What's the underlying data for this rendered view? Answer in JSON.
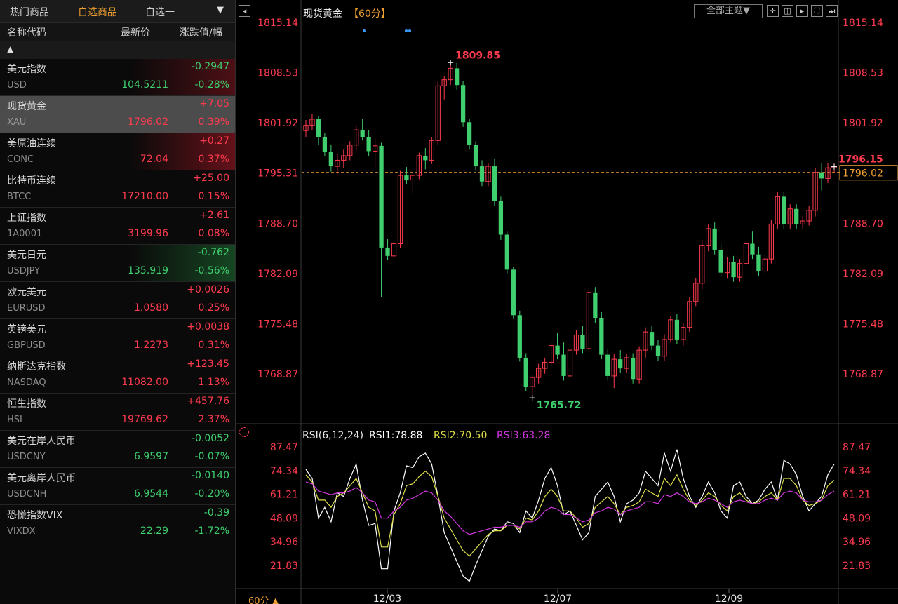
{
  "tabs": [
    "热门商品",
    "自选商品",
    "自选一"
  ],
  "tab_dropdown": "▼",
  "columns": {
    "name": "名称代码",
    "price": "最新价",
    "change": "涨跌值/幅"
  },
  "sort_indicator": "▲",
  "watchlist": [
    {
      "name": "美元指数",
      "code": "USD",
      "price": "104.5211",
      "change": "-0.2947",
      "pct": "-0.28%",
      "dir": "down"
    },
    {
      "name": "现货黄金",
      "code": "XAU",
      "price": "1796.02",
      "change": "+7.05",
      "pct": "0.39%",
      "dir": "up"
    },
    {
      "name": "美原油连续",
      "code": "CONC",
      "price": "72.04",
      "change": "+0.27",
      "pct": "0.37%",
      "dir": "up"
    },
    {
      "name": "比特币连续",
      "code": "BTCC",
      "price": "17210.00",
      "change": "+25.00",
      "pct": "0.15%",
      "dir": "up"
    },
    {
      "name": "上证指数",
      "code": "1A0001",
      "price": "3199.96",
      "change": "+2.61",
      "pct": "0.08%",
      "dir": "up"
    },
    {
      "name": "美元日元",
      "code": "USDJPY",
      "price": "135.919",
      "change": "-0.762",
      "pct": "-0.56%",
      "dir": "down"
    },
    {
      "name": "欧元美元",
      "code": "EURUSD",
      "price": "1.0580",
      "change": "+0.0026",
      "pct": "0.25%",
      "dir": "up"
    },
    {
      "name": "英镑美元",
      "code": "GBPUSD",
      "price": "1.2273",
      "change": "+0.0038",
      "pct": "0.31%",
      "dir": "up"
    },
    {
      "name": "纳斯达克指数",
      "code": "NASDAQ",
      "price": "11082.00",
      "change": "+123.45",
      "pct": "1.13%",
      "dir": "up"
    },
    {
      "name": "恒生指数",
      "code": "HSI",
      "price": "19769.62",
      "change": "+457.76",
      "pct": "2.37%",
      "dir": "up"
    },
    {
      "name": "美元在岸人民币",
      "code": "USDCNY",
      "price": "6.9597",
      "change": "-0.0052",
      "pct": "-0.07%",
      "dir": "down"
    },
    {
      "name": "美元离岸人民币",
      "code": "USDCNH",
      "price": "6.9544",
      "change": "-0.0140",
      "pct": "-0.20%",
      "dir": "down"
    },
    {
      "name": "恐慌指数VIX",
      "code": "VIXDX",
      "price": "22.29",
      "change": "-0.39",
      "pct": "-1.72%",
      "dir": "down"
    }
  ],
  "chart_header": {
    "title": "现货黄金",
    "period": "【60分】",
    "theme_button": "全部主题▼"
  },
  "toolbar_icons": [
    "crosshair-icon",
    "split-layout-icon",
    "next-frame-icon",
    "fullscreen-icon",
    "end-bar-icon"
  ],
  "rsi_header": {
    "label": "RSI(6,12,24)",
    "rsi1": "RSI1:78.88",
    "rsi2": "RSI2:70.50",
    "rsi3": "RSI3:63.28"
  },
  "bottom_period": "60分 ▲",
  "colors": {
    "up": "#ff3b4e",
    "down": "#3fcf6e",
    "rsi1": "#ffffff",
    "rsi2": "#e0e04a",
    "rsi3": "#d238e0",
    "last_price": "#f0a030"
  },
  "chart_data": [
    {
      "type": "candlestick",
      "title": "现货黄金",
      "yticks": [
        "1815.14",
        "1808.53",
        "1801.92",
        "1795.31",
        "1788.70",
        "1782.09",
        "1775.48",
        "1768.87"
      ],
      "ylim": [
        1761.0,
        1816.0
      ],
      "xticks": [
        "12/03",
        "12/07",
        "12/09"
      ],
      "high_label": "1809.85",
      "low_label": "1765.72",
      "last_label": "1796.15",
      "current_price": "1796.02",
      "reference_price": 1795.4,
      "ohlc": [
        [
          1800.9,
          1802.3,
          1800.0,
          1801.6
        ],
        [
          1801.6,
          1803.1,
          1801.0,
          1802.4
        ],
        [
          1802.4,
          1802.8,
          1799.0,
          1800.0
        ],
        [
          1800.0,
          1800.6,
          1797.5,
          1798.1
        ],
        [
          1798.1,
          1799.0,
          1795.5,
          1796.2
        ],
        [
          1796.2,
          1797.8,
          1795.2,
          1797.0
        ],
        [
          1797.0,
          1798.4,
          1796.0,
          1797.6
        ],
        [
          1797.6,
          1799.5,
          1797.0,
          1799.0
        ],
        [
          1799.0,
          1801.5,
          1798.3,
          1801.0
        ],
        [
          1801.0,
          1802.4,
          1799.6,
          1800.0
        ],
        [
          1800.0,
          1801.0,
          1797.6,
          1798.2
        ],
        [
          1798.2,
          1799.8,
          1796.1,
          1798.9
        ],
        [
          1798.9,
          1799.3,
          1779.0,
          1785.5
        ],
        [
          1785.5,
          1786.6,
          1783.9,
          1784.4
        ],
        [
          1784.4,
          1786.6,
          1784.0,
          1786.0
        ],
        [
          1786.0,
          1795.6,
          1785.5,
          1795.0
        ],
        [
          1795.0,
          1796.1,
          1793.9,
          1794.4
        ],
        [
          1794.4,
          1795.5,
          1792.6,
          1795.0
        ],
        [
          1795.0,
          1798.0,
          1794.5,
          1797.6
        ],
        [
          1797.6,
          1798.6,
          1795.8,
          1797.0
        ],
        [
          1797.0,
          1800.0,
          1796.5,
          1799.6
        ],
        [
          1799.6,
          1807.4,
          1799.0,
          1806.8
        ],
        [
          1806.8,
          1808.1,
          1805.0,
          1807.6
        ],
        [
          1807.6,
          1809.85,
          1806.9,
          1809.1
        ],
        [
          1809.1,
          1809.8,
          1806.3,
          1806.9
        ],
        [
          1806.9,
          1807.4,
          1801.4,
          1802.0
        ],
        [
          1802.0,
          1802.4,
          1798.4,
          1799.0
        ],
        [
          1799.0,
          1799.5,
          1795.6,
          1796.2
        ],
        [
          1796.2,
          1797.0,
          1793.6,
          1794.2
        ],
        [
          1794.2,
          1796.6,
          1793.6,
          1796.2
        ],
        [
          1796.2,
          1797.2,
          1791.0,
          1791.6
        ],
        [
          1791.6,
          1792.2,
          1786.5,
          1787.2
        ],
        [
          1787.2,
          1787.6,
          1782.1,
          1782.6
        ],
        [
          1782.6,
          1783.0,
          1776.1,
          1776.6
        ],
        [
          1776.6,
          1777.2,
          1770.5,
          1771.0
        ],
        [
          1771.0,
          1771.6,
          1766.6,
          1767.2
        ],
        [
          1767.2,
          1768.8,
          1765.72,
          1768.4
        ],
        [
          1768.4,
          1770.2,
          1767.6,
          1769.6
        ],
        [
          1769.6,
          1771.0,
          1768.9,
          1770.4
        ],
        [
          1770.4,
          1773.0,
          1769.9,
          1772.6
        ],
        [
          1772.6,
          1774.3,
          1770.8,
          1771.4
        ],
        [
          1771.4,
          1773.0,
          1768.0,
          1768.6
        ],
        [
          1768.6,
          1772.6,
          1768.0,
          1772.0
        ],
        [
          1772.0,
          1774.6,
          1771.4,
          1774.0
        ],
        [
          1774.0,
          1775.2,
          1771.6,
          1772.2
        ],
        [
          1772.2,
          1780.2,
          1771.8,
          1779.6
        ],
        [
          1779.6,
          1780.3,
          1775.6,
          1776.2
        ],
        [
          1776.2,
          1777.0,
          1770.8,
          1771.4
        ],
        [
          1771.4,
          1772.2,
          1768.0,
          1768.6
        ],
        [
          1768.6,
          1771.5,
          1767.0,
          1770.8
        ],
        [
          1770.8,
          1772.0,
          1769.0,
          1769.6
        ],
        [
          1769.6,
          1771.5,
          1769.0,
          1771.0
        ],
        [
          1771.0,
          1771.6,
          1767.6,
          1768.2
        ],
        [
          1768.2,
          1772.5,
          1767.6,
          1772.0
        ],
        [
          1772.0,
          1775.0,
          1771.0,
          1774.4
        ],
        [
          1774.4,
          1775.2,
          1772.0,
          1772.6
        ],
        [
          1772.6,
          1773.4,
          1770.6,
          1771.2
        ],
        [
          1771.2,
          1774.1,
          1770.6,
          1773.4
        ],
        [
          1773.4,
          1776.5,
          1773.0,
          1776.0
        ],
        [
          1776.0,
          1776.8,
          1772.8,
          1773.4
        ],
        [
          1773.4,
          1775.6,
          1772.6,
          1775.0
        ],
        [
          1775.0,
          1779.0,
          1774.4,
          1778.4
        ],
        [
          1778.4,
          1781.5,
          1777.8,
          1780.8
        ],
        [
          1780.8,
          1786.5,
          1780.0,
          1785.8
        ],
        [
          1785.8,
          1788.6,
          1785.0,
          1788.0
        ],
        [
          1788.0,
          1788.8,
          1784.6,
          1785.2
        ],
        [
          1785.2,
          1786.0,
          1781.6,
          1782.2
        ],
        [
          1782.2,
          1784.2,
          1781.4,
          1783.6
        ],
        [
          1783.6,
          1784.4,
          1781.0,
          1781.6
        ],
        [
          1781.6,
          1784.0,
          1781.0,
          1783.4
        ],
        [
          1783.4,
          1786.7,
          1783.0,
          1786.0
        ],
        [
          1786.0,
          1787.6,
          1784.0,
          1784.6
        ],
        [
          1784.6,
          1785.6,
          1781.8,
          1782.4
        ],
        [
          1782.4,
          1784.5,
          1782.0,
          1784.0
        ],
        [
          1784.0,
          1789.2,
          1783.4,
          1788.6
        ],
        [
          1788.6,
          1792.8,
          1788.0,
          1792.2
        ],
        [
          1792.2,
          1792.8,
          1788.0,
          1788.6
        ],
        [
          1788.6,
          1791.2,
          1788.0,
          1790.6
        ],
        [
          1790.6,
          1791.2,
          1788.0,
          1788.6
        ],
        [
          1788.6,
          1789.6,
          1788.0,
          1789.0
        ],
        [
          1789.0,
          1791.0,
          1788.4,
          1790.4
        ],
        [
          1790.4,
          1796.0,
          1789.6,
          1795.4
        ],
        [
          1795.4,
          1796.6,
          1793.0,
          1794.6
        ],
        [
          1794.6,
          1796.6,
          1794.0,
          1796.0
        ],
        [
          1796.0,
          1796.6,
          1795.4,
          1796.15
        ]
      ]
    },
    {
      "type": "line",
      "title": "RSI(6,12,24)",
      "yticks": [
        "87.47",
        "74.34",
        "61.21",
        "48.09",
        "34.96",
        "21.83"
      ],
      "ylim": [
        17.0,
        92.0
      ],
      "series": [
        {
          "name": "RSI1",
          "color": "#ffffff",
          "values": [
            75,
            70,
            48,
            54,
            46,
            62,
            60,
            70,
            78,
            58,
            44,
            45,
            20,
            20,
            52,
            62,
            77,
            76,
            82,
            84,
            78,
            60,
            40,
            32,
            24,
            16,
            13,
            22,
            30,
            38,
            42,
            41,
            46,
            45,
            40,
            52,
            48,
            58,
            70,
            76,
            66,
            50,
            52,
            44,
            36,
            40,
            60,
            64,
            68,
            60,
            46,
            56,
            58,
            62,
            74,
            70,
            66,
            84,
            74,
            86,
            70,
            60,
            54,
            60,
            68,
            62,
            52,
            48,
            66,
            68,
            60,
            56,
            58,
            64,
            68,
            58,
            80,
            78,
            72,
            60,
            52,
            56,
            60,
            72,
            78
          ]
        },
        {
          "name": "RSI2",
          "color": "#e0e04a",
          "values": [
            72,
            68,
            58,
            58,
            54,
            60,
            62,
            66,
            70,
            62,
            54,
            52,
            32,
            32,
            50,
            56,
            66,
            67,
            71,
            74,
            71,
            60,
            48,
            42,
            36,
            30,
            27,
            31,
            35,
            39,
            41,
            41,
            44,
            44,
            42,
            48,
            47,
            52,
            60,
            64,
            60,
            52,
            52,
            48,
            43,
            45,
            54,
            57,
            60,
            56,
            50,
            54,
            55,
            57,
            64,
            62,
            60,
            70,
            66,
            72,
            64,
            58,
            55,
            58,
            62,
            60,
            55,
            52,
            60,
            62,
            58,
            56,
            57,
            60,
            62,
            58,
            70,
            70,
            66,
            58,
            55,
            56,
            58,
            66,
            69
          ]
        },
        {
          "name": "RSI3",
          "color": "#d238e0",
          "values": [
            68,
            67,
            63,
            62,
            61,
            62,
            62,
            63,
            65,
            62,
            58,
            57,
            48,
            48,
            52,
            54,
            58,
            59,
            61,
            63,
            62,
            58,
            52,
            49,
            45,
            41,
            39,
            40,
            41,
            42,
            43,
            43,
            44,
            44,
            43,
            46,
            46,
            48,
            52,
            54,
            53,
            50,
            50,
            48,
            46,
            47,
            51,
            52,
            54,
            53,
            50,
            52,
            53,
            54,
            57,
            57,
            56,
            61,
            60,
            62,
            60,
            57,
            56,
            57,
            59,
            58,
            56,
            54,
            57,
            58,
            57,
            56,
            56,
            58,
            59,
            58,
            62,
            63,
            62,
            58,
            57,
            57,
            58,
            61,
            63
          ]
        }
      ]
    }
  ]
}
